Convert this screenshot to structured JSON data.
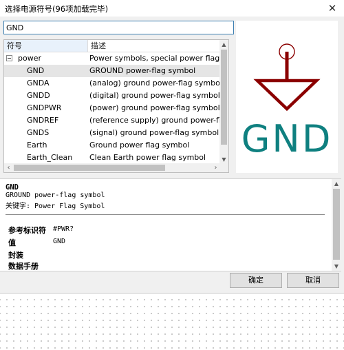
{
  "window": {
    "title": "选择电源符号(96项加载完毕)",
    "close_glyph": "✕"
  },
  "search": {
    "value": "GND"
  },
  "tree": {
    "columns": [
      "符号",
      "描述"
    ],
    "rows": [
      {
        "name": "power",
        "desc": "Power symbols, special power flags",
        "level": 0,
        "expanded": true
      },
      {
        "name": "GND",
        "desc": "GROUND power-flag symbol",
        "level": 1,
        "selected": true
      },
      {
        "name": "GNDA",
        "desc": "(analog) ground power-flag symbol",
        "level": 1
      },
      {
        "name": "GNDD",
        "desc": "(digital) ground power-flag symbol",
        "level": 1
      },
      {
        "name": "GNDPWR",
        "desc": "(power) ground power-flag symbol",
        "level": 1
      },
      {
        "name": "GNDREF",
        "desc": "(reference supply) ground power-flag",
        "level": 1
      },
      {
        "name": "GNDS",
        "desc": "(signal) ground power-flag symbol",
        "level": 1
      },
      {
        "name": "Earth",
        "desc": "Ground power flag symbol",
        "level": 1
      },
      {
        "name": "Earth_Clean",
        "desc": "Clean Earth power flag symbol",
        "level": 1
      }
    ]
  },
  "preview": {
    "label": "GND",
    "symbol_color": "#8b0000",
    "text_color": "#0f8080"
  },
  "details": {
    "name": "GND",
    "description": "GROUND power-flag symbol",
    "keywords": "关键字: Power Flag Symbol",
    "fields": [
      {
        "label": "参考标识符",
        "value": "#PWR?"
      },
      {
        "label": "值",
        "value": "GND"
      },
      {
        "label": "封装",
        "value": ""
      },
      {
        "label": "数据手册",
        "value": ""
      }
    ]
  },
  "buttons": {
    "ok": "确定",
    "cancel": "取消"
  }
}
